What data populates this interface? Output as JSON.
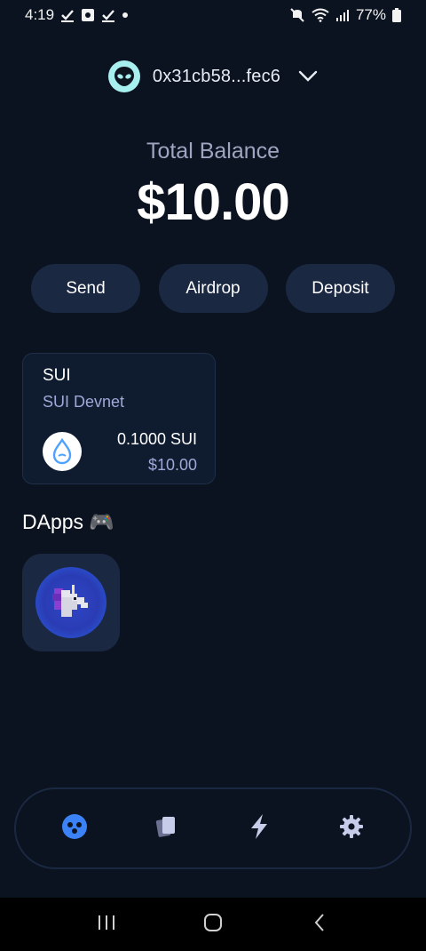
{
  "status_bar": {
    "time": "4:19",
    "battery": "77%",
    "icons": [
      "check-icon",
      "check-icon",
      "square-icon",
      "check-icon",
      "dot-icon",
      "mute-icon",
      "wifi-icon",
      "signal-icon",
      "battery-icon"
    ]
  },
  "account": {
    "address": "0x31cb58...fec6",
    "avatar_icon": "alien-icon",
    "dropdown_icon": "chevron-down-icon"
  },
  "balance": {
    "label": "Total Balance",
    "value": "$10.00"
  },
  "actions": [
    {
      "label": "Send"
    },
    {
      "label": "Airdrop"
    },
    {
      "label": "Deposit"
    }
  ],
  "token": {
    "symbol": "SUI",
    "network": "SUI Devnet",
    "amount": "0.1000 SUI",
    "usd": "$10.00",
    "icon": "sui-drop-icon"
  },
  "dapps": {
    "title": "DApps",
    "emoji": "🎮",
    "items": [
      {
        "icon": "unicorn-icon"
      }
    ]
  },
  "tabbar": {
    "items": [
      {
        "icon": "dapps-icon",
        "active": true
      },
      {
        "icon": "cards-icon",
        "active": false
      },
      {
        "icon": "bolt-icon",
        "active": false
      },
      {
        "icon": "gear-icon",
        "active": false
      }
    ]
  },
  "colors": {
    "background": "#0b1320",
    "surface": "#1a2842",
    "accent": "#3b82f6",
    "muted_text": "#9fa8d8",
    "inactive_icon": "#c7cde8"
  }
}
